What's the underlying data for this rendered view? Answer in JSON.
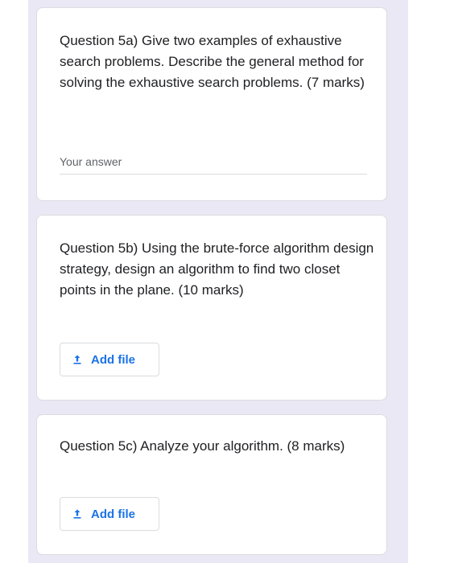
{
  "questions": [
    {
      "text": "Question 5a) Give two examples of exhaustive search problems. Describe the general method for solving the exhaustive search problems. (7 marks)",
      "answer_placeholder": "Your answer"
    },
    {
      "text": "Question 5b) Using the brute-force algorithm design strategy, design an algorithm to find two closet points in the plane. (10 marks)",
      "button_label": "Add file",
      "button_icon": "upload-icon"
    },
    {
      "text": "Question 5c) Analyze your algorithm. (8 marks)",
      "button_label": "Add file",
      "button_icon": "upload-icon"
    }
  ],
  "colors": {
    "background": "#ebe8f5",
    "card": "#ffffff",
    "accent": "#1a73e8",
    "text": "#202124"
  }
}
